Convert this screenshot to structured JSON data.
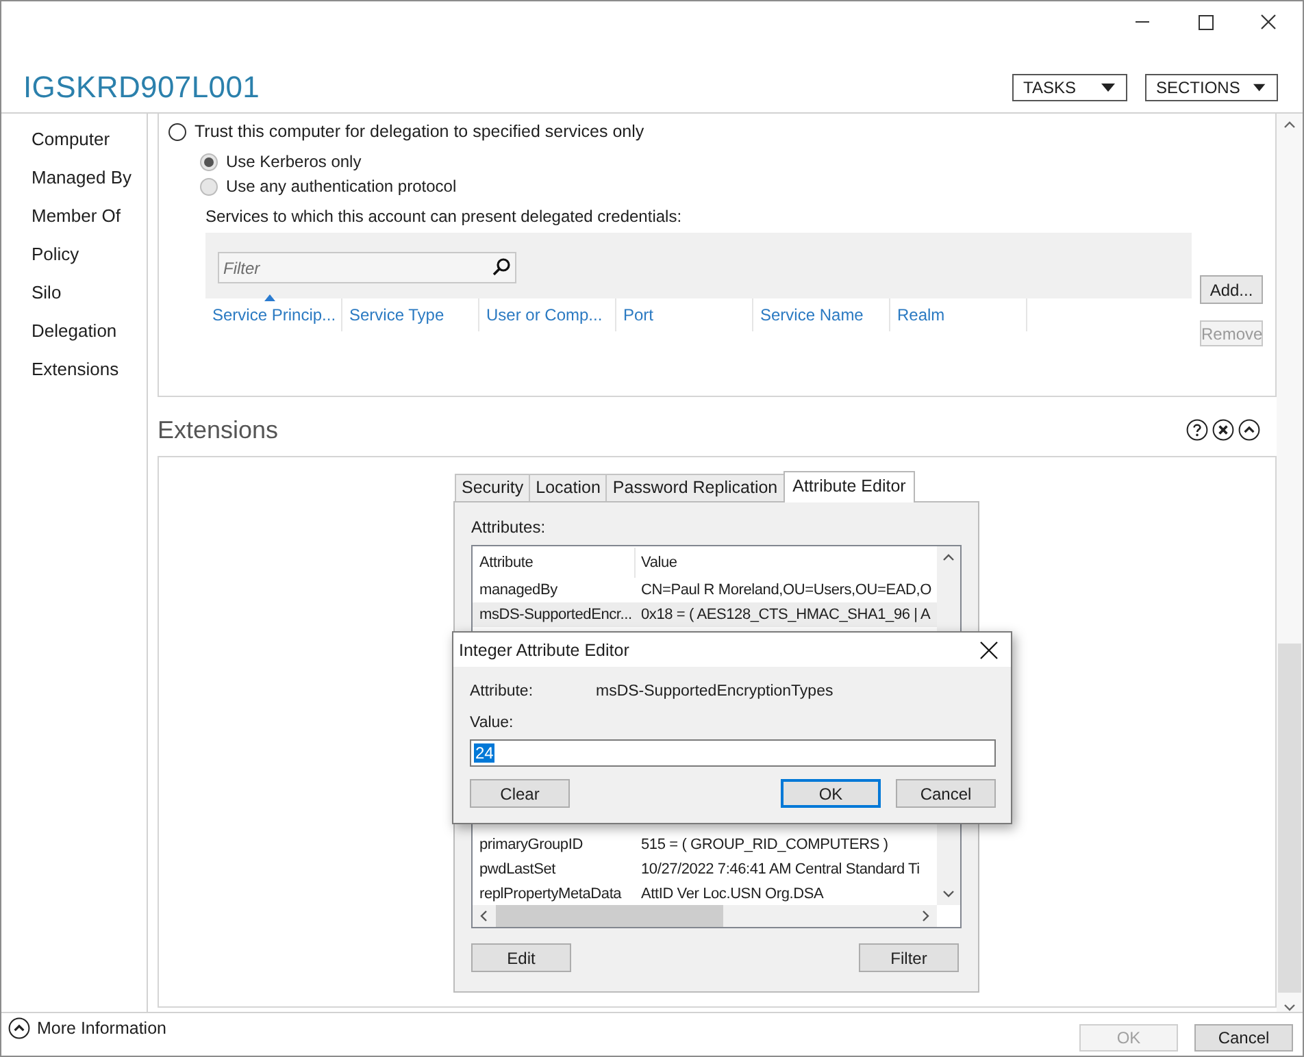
{
  "header": {
    "title": "IGSKRD907L001",
    "buttons": [
      {
        "label": "TASKS"
      },
      {
        "label": "SECTIONS"
      }
    ]
  },
  "sidebar": {
    "items": [
      {
        "label": "Computer",
        "selected": false
      },
      {
        "label": "Managed By",
        "selected": false
      },
      {
        "label": "Member Of",
        "selected": false
      },
      {
        "label": "Policy",
        "selected": false
      },
      {
        "label": "Silo",
        "selected": false
      },
      {
        "label": "Delegation",
        "selected": false
      },
      {
        "label": "Extensions",
        "selected": false
      }
    ]
  },
  "delegation": {
    "trust_option": {
      "label": "Trust this computer for delegation to specified services only",
      "selected": false
    },
    "protocol_options": [
      {
        "label": "Use Kerberos only",
        "selected": true
      },
      {
        "label": "Use any authentication protocol",
        "selected": false
      }
    ],
    "services_label": "Services to which this account can present delegated credentials:",
    "filter": {
      "placeholder": "Filter"
    },
    "columns": [
      {
        "label": "Service Princip...",
        "sorted": true
      },
      {
        "label": "Service Type",
        "sorted": false
      },
      {
        "label": "User or Comp...",
        "sorted": false
      },
      {
        "label": "Port",
        "sorted": false
      },
      {
        "label": "Service Name",
        "sorted": false
      },
      {
        "label": "Realm",
        "sorted": false
      }
    ],
    "buttons": [
      {
        "label": "Add...",
        "disabled": false
      },
      {
        "label": "Remove",
        "disabled": true
      }
    ]
  },
  "extensions": {
    "title": "Extensions",
    "tabs": [
      {
        "label": "Security",
        "selected": false
      },
      {
        "label": "Location",
        "selected": false
      },
      {
        "label": "Password Replication",
        "selected": false
      },
      {
        "label": "Attribute Editor",
        "selected": true
      }
    ],
    "attributes_label": "Attributes:",
    "columns": [
      "Attribute",
      "Value"
    ],
    "rows": [
      {
        "attribute": "managedBy",
        "value": "CN=Paul R Moreland,OU=Users,OU=EAD,O",
        "selected": false
      },
      {
        "attribute": "msDS-SupportedEncr...",
        "value": "0x18 = ( AES128_CTS_HMAC_SHA1_96 | A",
        "selected": true
      },
      {
        "attribute": "primaryGroupID",
        "value": "515 = ( GROUP_RID_COMPUTERS )",
        "selected": false
      },
      {
        "attribute": "pwdLastSet",
        "value": "10/27/2022 7:46:41 AM Central Standard Ti",
        "selected": false
      },
      {
        "attribute": "replPropertyMetaData",
        "value": "AttID  Ver   Loc.USN            Org.DSA",
        "selected": false
      }
    ],
    "buttons": [
      {
        "label": "Edit"
      },
      {
        "label": "Filter"
      }
    ]
  },
  "dialog": {
    "title": "Integer Attribute Editor",
    "attribute_label": "Attribute:",
    "attribute_value": "msDS-SupportedEncryptionTypes",
    "value_label": "Value:",
    "value": "24",
    "buttons": [
      {
        "label": "Clear",
        "default": false
      },
      {
        "label": "OK",
        "default": true
      },
      {
        "label": "Cancel",
        "default": false
      }
    ]
  },
  "footer": {
    "more_info": "More Information",
    "buttons": [
      {
        "label": "OK",
        "disabled": true
      },
      {
        "label": "Cancel",
        "disabled": false
      }
    ]
  }
}
